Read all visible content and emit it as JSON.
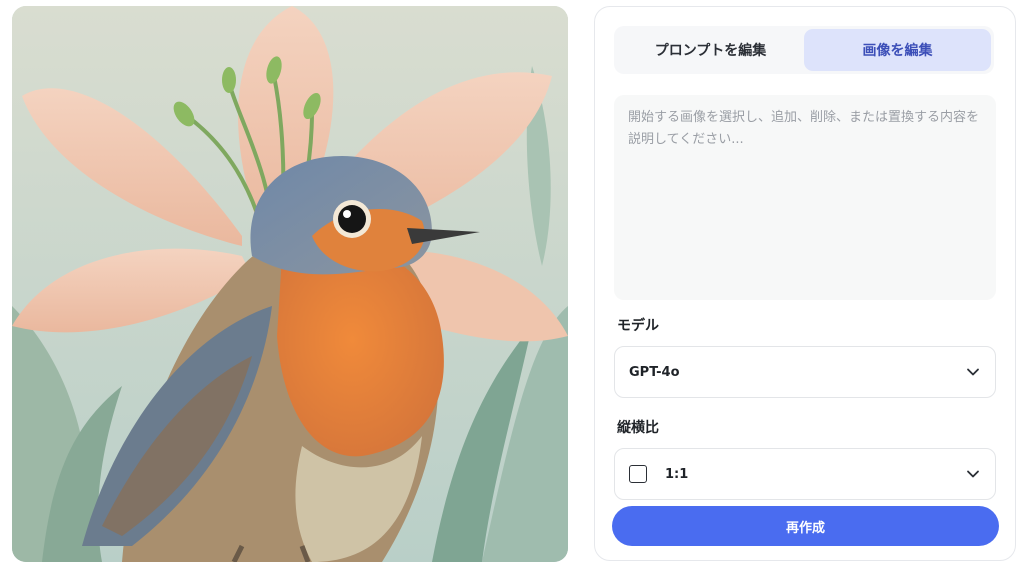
{
  "image": {
    "alt_icon": "robin-lily-illustration"
  },
  "tabs": [
    {
      "label": "プロンプトを編集",
      "active": false
    },
    {
      "label": "画像を編集",
      "active": true
    }
  ],
  "prompt": {
    "placeholder": "開始する画像を選択し、追加、削除、または置換する内容を説明してください...",
    "value": ""
  },
  "model": {
    "label": "モデル",
    "selected": "GPT-4o"
  },
  "aspect_ratio": {
    "label": "縦横比",
    "selected": "1:1"
  },
  "actions": {
    "regenerate_label": "再作成"
  },
  "colors": {
    "accent": "#4a6cf0",
    "active_tab_bg": "#dde3fb",
    "active_tab_text": "#3c4fb8"
  }
}
